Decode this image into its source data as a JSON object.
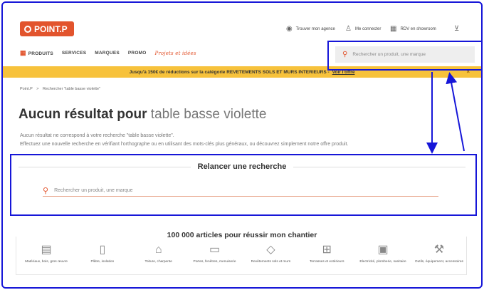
{
  "header": {
    "logo_text": "POINT.P",
    "utilities": [
      {
        "icon": "globe-icon",
        "glyph": "◉",
        "label": "Trouver mon agence"
      },
      {
        "icon": "user-icon",
        "glyph": "♙",
        "label": "Me connecter"
      },
      {
        "icon": "calendar-icon",
        "glyph": "▦",
        "label": "RDV en showroom"
      },
      {
        "icon": "cart-icon",
        "glyph": "⊻",
        "label": ""
      }
    ]
  },
  "nav": {
    "items": [
      "PRODUITS",
      "SERVICES",
      "MARQUES",
      "PROMO"
    ],
    "projets": "Projets et idées"
  },
  "search_top": {
    "placeholder": "Rechercher un produit, une marque"
  },
  "promo_banner": {
    "text": "Jusqu'à 150€ de réductions sur la catégorie REVETEMENTS SOLS ET MURS INTERIEURS -",
    "link": "Voir l'offre",
    "close": "×"
  },
  "breadcrumb": {
    "home": "Point.P",
    "sep": ">",
    "current": "Rechercher \"table basse violette\""
  },
  "result": {
    "title_prefix": "Aucun résultat pour",
    "query": "table basse violette",
    "line1": "Aucun résultat ne correspond à votre recherche \"table basse violette\".",
    "line2": "Effectuez une nouvelle recherche en vérifiant l'orthographe ou en utilisant des mots-clés plus généraux, ou découvrez simplement notre offre produit."
  },
  "relaunch": {
    "title": "Relancer une recherche",
    "placeholder": "Rechercher un produit, une marque"
  },
  "categories": {
    "title": "100 000 articles pour réussir mon chantier",
    "items": [
      {
        "icon": "bricks-icon",
        "glyph": "▤",
        "label": "Matériaux, bois, gros œuvre"
      },
      {
        "icon": "plaster-icon",
        "glyph": "▯",
        "label": "Plâtre, isolation"
      },
      {
        "icon": "roof-icon",
        "glyph": "⌂",
        "label": "Toiture, charpente"
      },
      {
        "icon": "door-icon",
        "glyph": "▭",
        "label": "Portes, fenêtres, menuiserie"
      },
      {
        "icon": "tiles-icon",
        "glyph": "◇",
        "label": "Revêtements sols et murs"
      },
      {
        "icon": "fence-icon",
        "glyph": "⊞",
        "label": "Terrasses et extérieurs"
      },
      {
        "icon": "plug-icon",
        "glyph": "▣",
        "label": "Electricité, plomberie, sanitaire"
      },
      {
        "icon": "drill-icon",
        "glyph": "⚒",
        "label": "Outils, équipement, accessoires"
      }
    ]
  },
  "colors": {
    "brand": "#e2542d",
    "banner": "#f7c23b",
    "annotation": "#1616d8"
  }
}
